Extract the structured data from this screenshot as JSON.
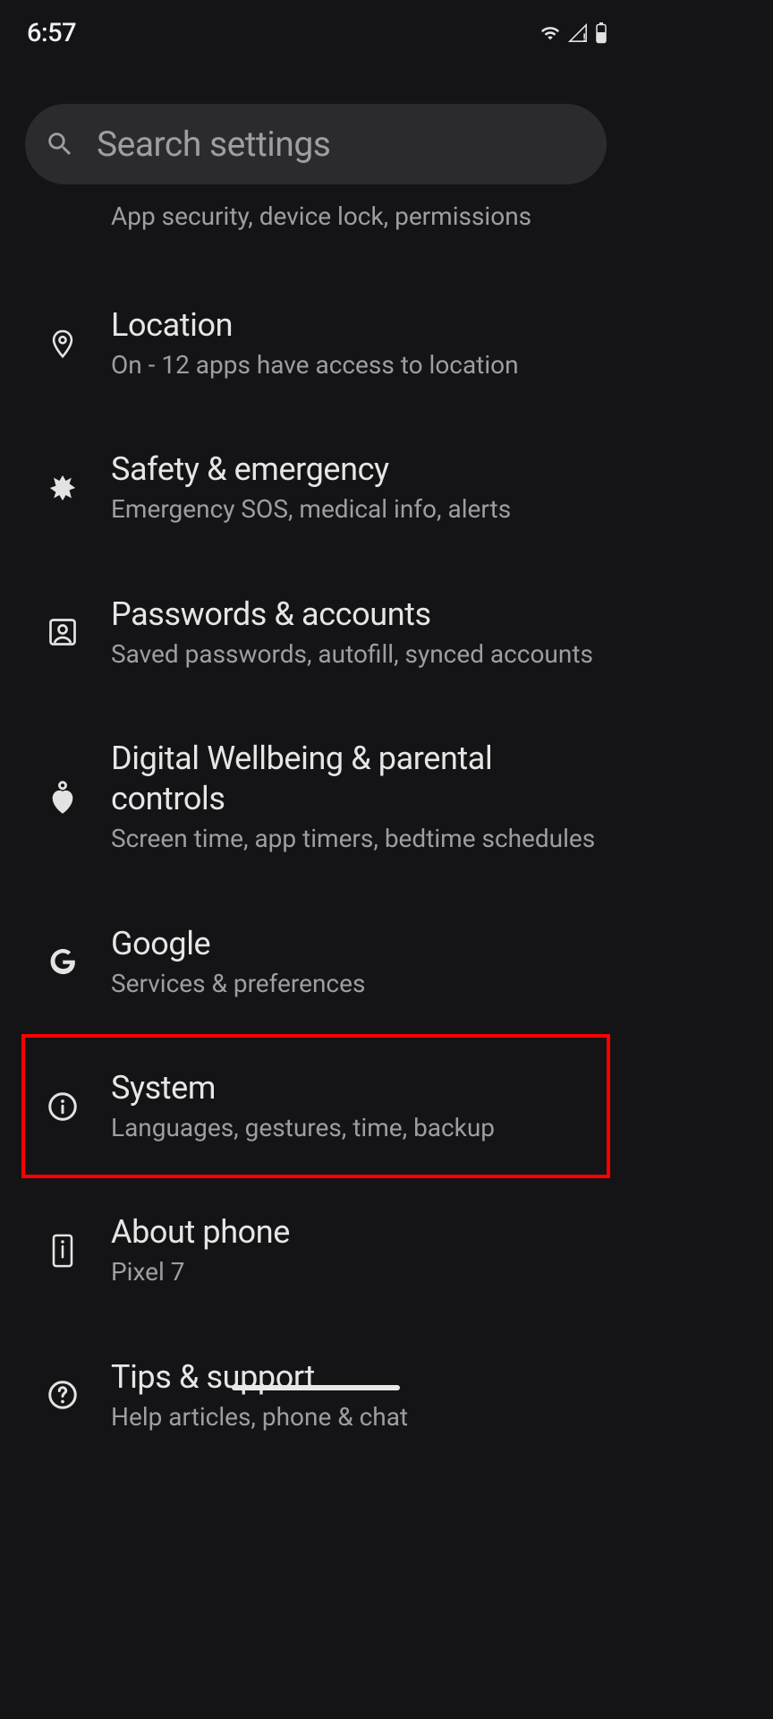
{
  "status": {
    "time": "6:57"
  },
  "search": {
    "placeholder": "Search settings"
  },
  "partial_item": {
    "subtitle": "App security, device lock, permissions"
  },
  "items": [
    {
      "id": "location",
      "title": "Location",
      "subtitle": "On - 12 apps have access to location",
      "icon": "location-icon",
      "highlight": false
    },
    {
      "id": "safety",
      "title": "Safety & emergency",
      "subtitle": "Emergency SOS, medical info, alerts",
      "icon": "medical-icon",
      "highlight": false
    },
    {
      "id": "passwords",
      "title": "Passwords & accounts",
      "subtitle": "Saved passwords, autofill, synced accounts",
      "icon": "account-box-icon",
      "highlight": false
    },
    {
      "id": "wellbeing",
      "title": "Digital Wellbeing & parental controls",
      "subtitle": "Screen time, app timers, bedtime schedules",
      "icon": "wellbeing-icon",
      "highlight": false
    },
    {
      "id": "google",
      "title": "Google",
      "subtitle": "Services & preferences",
      "icon": "google-icon",
      "highlight": false
    },
    {
      "id": "system",
      "title": "System",
      "subtitle": "Languages, gestures, time, backup",
      "icon": "info-icon",
      "highlight": true
    },
    {
      "id": "about",
      "title": "About phone",
      "subtitle": "Pixel 7",
      "icon": "phone-info-icon",
      "highlight": false
    },
    {
      "id": "tips",
      "title": "Tips & support",
      "subtitle": "Help articles, phone & chat",
      "icon": "help-icon",
      "highlight": false
    }
  ]
}
